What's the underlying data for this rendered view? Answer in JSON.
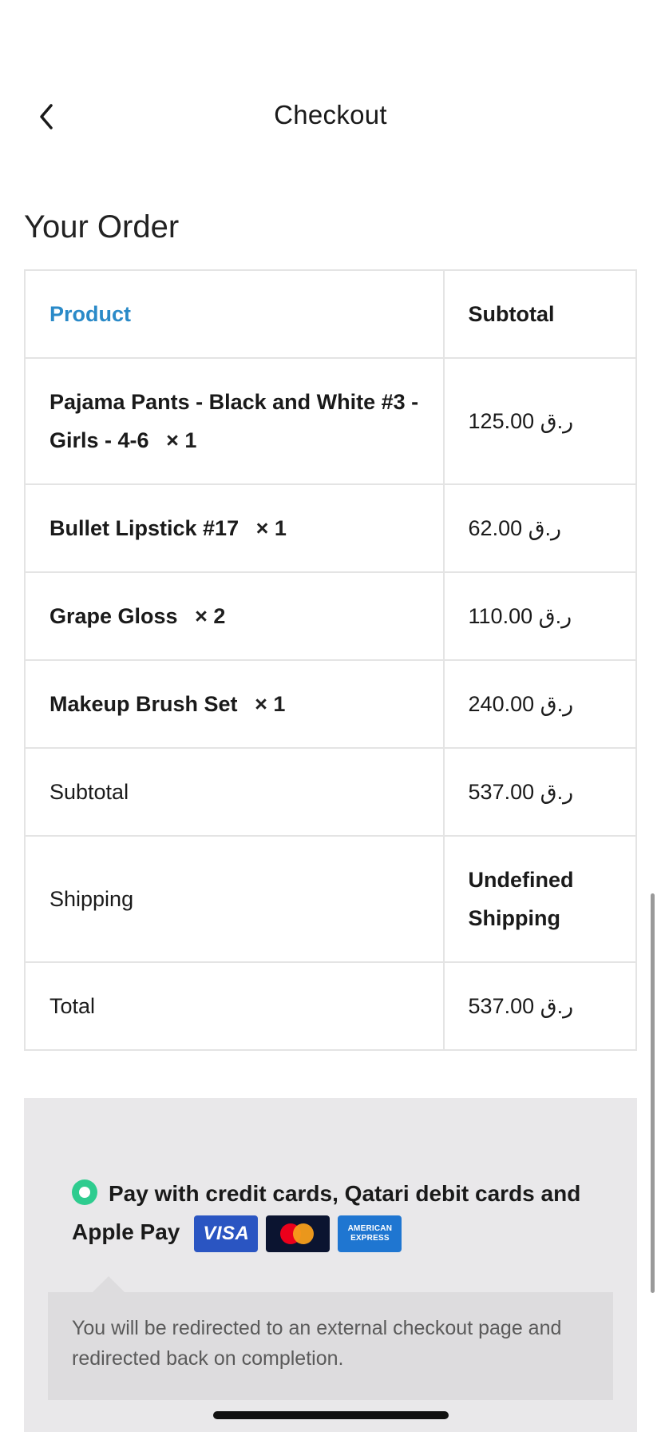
{
  "header": {
    "title": "Checkout",
    "back_icon": "chevron-left-icon"
  },
  "order": {
    "section_title": "Your Order",
    "columns": [
      "Product",
      "Subtotal"
    ],
    "items": [
      {
        "name": "Pajama Pants - Black and White #3 - Girls - 4-6",
        "qty": "× 1",
        "price": "125.00 ر.ق"
      },
      {
        "name": "Bullet Lipstick #17",
        "qty": "× 1",
        "price": "62.00 ر.ق"
      },
      {
        "name": "Grape Gloss",
        "qty": "× 2",
        "price": "110.00 ر.ق"
      },
      {
        "name": "Makeup Brush Set",
        "qty": "× 1",
        "price": "240.00 ر.ق"
      }
    ],
    "subtotal": {
      "label": "Subtotal",
      "value": "537.00 ر.ق"
    },
    "shipping": {
      "label": "Shipping",
      "value": "Undefined Shipping"
    },
    "total": {
      "label": "Total",
      "value": "537.00 ر.ق"
    }
  },
  "payment": {
    "option_label": "Pay with credit cards, Qatari debit cards and Apple Pay",
    "selected": true,
    "cards": [
      "VISA",
      "mastercard",
      "AMERICAN EXPRESS"
    ],
    "info_text": "You will be redirected to an external checkout page and redirected back on completion."
  },
  "colors": {
    "link_blue": "#2a8ac8",
    "radio_green": "#2ecc8f",
    "payment_bg": "#e9e8ea",
    "info_bg": "#dddcde"
  }
}
